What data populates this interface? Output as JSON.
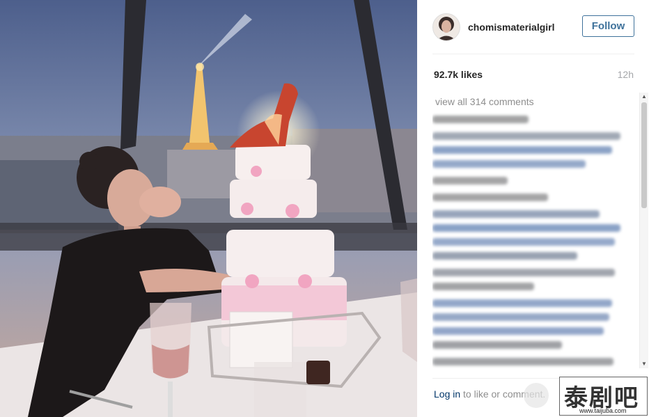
{
  "post": {
    "username": "chomismaterialgirl",
    "follow_label": "Follow",
    "likes": "92.7k likes",
    "time_ago": "12h",
    "view_all_comments": "view all 314 comments"
  },
  "footer": {
    "login_link": "Log in",
    "login_rest": " to like or comment."
  },
  "watermark": {
    "text": "泰剧吧",
    "url": "www.taijuba.com"
  },
  "colors": {
    "follow_blue": "#3f729b",
    "link_blue": "#003569",
    "muted_gray": "#8e8e8e"
  }
}
